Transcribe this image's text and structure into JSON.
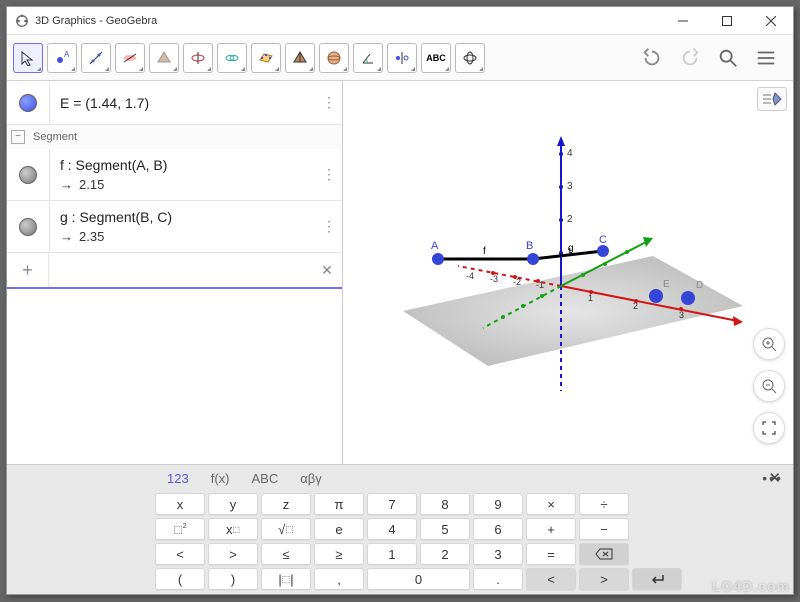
{
  "window": {
    "title": "3D Graphics - GeoGebra"
  },
  "algebra": {
    "pointE": "E = (1.44, 1.7)",
    "sectionLabel": "Segment",
    "segF": {
      "def": "f : Segment(A, B)",
      "val": "2.15"
    },
    "segG": {
      "def": "g : Segment(B, C)",
      "val": "2.35"
    }
  },
  "keyboard": {
    "tabs": {
      "123": "123",
      "fx": "f(x)",
      "abc": "ABC",
      "greek": "αβγ"
    },
    "rows": [
      [
        "x",
        "y",
        "z",
        "π",
        "7",
        "8",
        "9",
        "×",
        "÷"
      ],
      [
        "▢²",
        "xⁿ",
        "√▢",
        "e",
        "4",
        "5",
        "6",
        "+",
        "−"
      ],
      [
        "<",
        ">",
        "≤",
        "≥",
        "1",
        "2",
        "3",
        "=",
        "⌫"
      ],
      [
        "(",
        ")",
        "|▢|",
        ",",
        "0",
        ".",
        "<",
        ">",
        "↵"
      ]
    ]
  },
  "watermark": "LO4D.com",
  "axes": {
    "x": [
      "-4",
      "-3",
      "-2",
      "-1",
      "1",
      "2",
      "3"
    ],
    "z": [
      "1",
      "2",
      "3",
      "4"
    ],
    "points": [
      "A",
      "B",
      "C",
      "D",
      "E"
    ],
    "segLabels": [
      "f",
      "g"
    ]
  }
}
